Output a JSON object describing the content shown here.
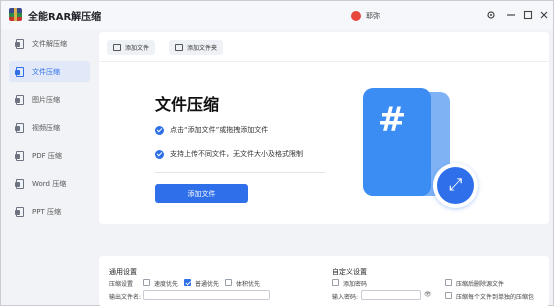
{
  "app": {
    "title": "全能RAR解压缩",
    "user_name": "耶弥"
  },
  "titlebar_icons": [
    "settings-icon",
    "minimize-icon",
    "maximize-icon",
    "close-icon"
  ],
  "sidebar": {
    "items": [
      {
        "label": "文件解压缩",
        "active": false
      },
      {
        "label": "文件压缩",
        "active": true
      },
      {
        "label": "图片压缩",
        "active": false
      },
      {
        "label": "视频压缩",
        "active": false
      },
      {
        "label": "PDF 压缩",
        "active": false
      },
      {
        "label": "Word 压缩",
        "active": false
      },
      {
        "label": "PPT 压缩",
        "active": false
      }
    ]
  },
  "toolbar": {
    "add_file": "添加文件",
    "add_folder": "添加文件夹"
  },
  "main": {
    "title": "文件压缩",
    "bullets": [
      "点击“添加文件”或拖拽添加文件",
      "支持上传不同文件，无文件大小及格式限制"
    ],
    "add_button": "添加文件"
  },
  "general_settings": {
    "title": "通用设置",
    "compress_label": "压缩设置",
    "options": [
      {
        "label": "速度优先",
        "checked": false
      },
      {
        "label": "普通优先",
        "checked": true
      },
      {
        "label": "体积优先",
        "checked": false
      }
    ],
    "output_label": "输出文件名:",
    "output_value": ""
  },
  "custom_settings": {
    "title": "自定义设置",
    "add_password": "添加密码",
    "input_password_label": "输入密码:",
    "delete_source": "压缩后删除源文件",
    "separate_each": "压缩每个文件到单独的压缩包"
  },
  "colors": {
    "accent": "#2f6fea",
    "background": "#f1f3f7",
    "card": "#ffffff"
  }
}
